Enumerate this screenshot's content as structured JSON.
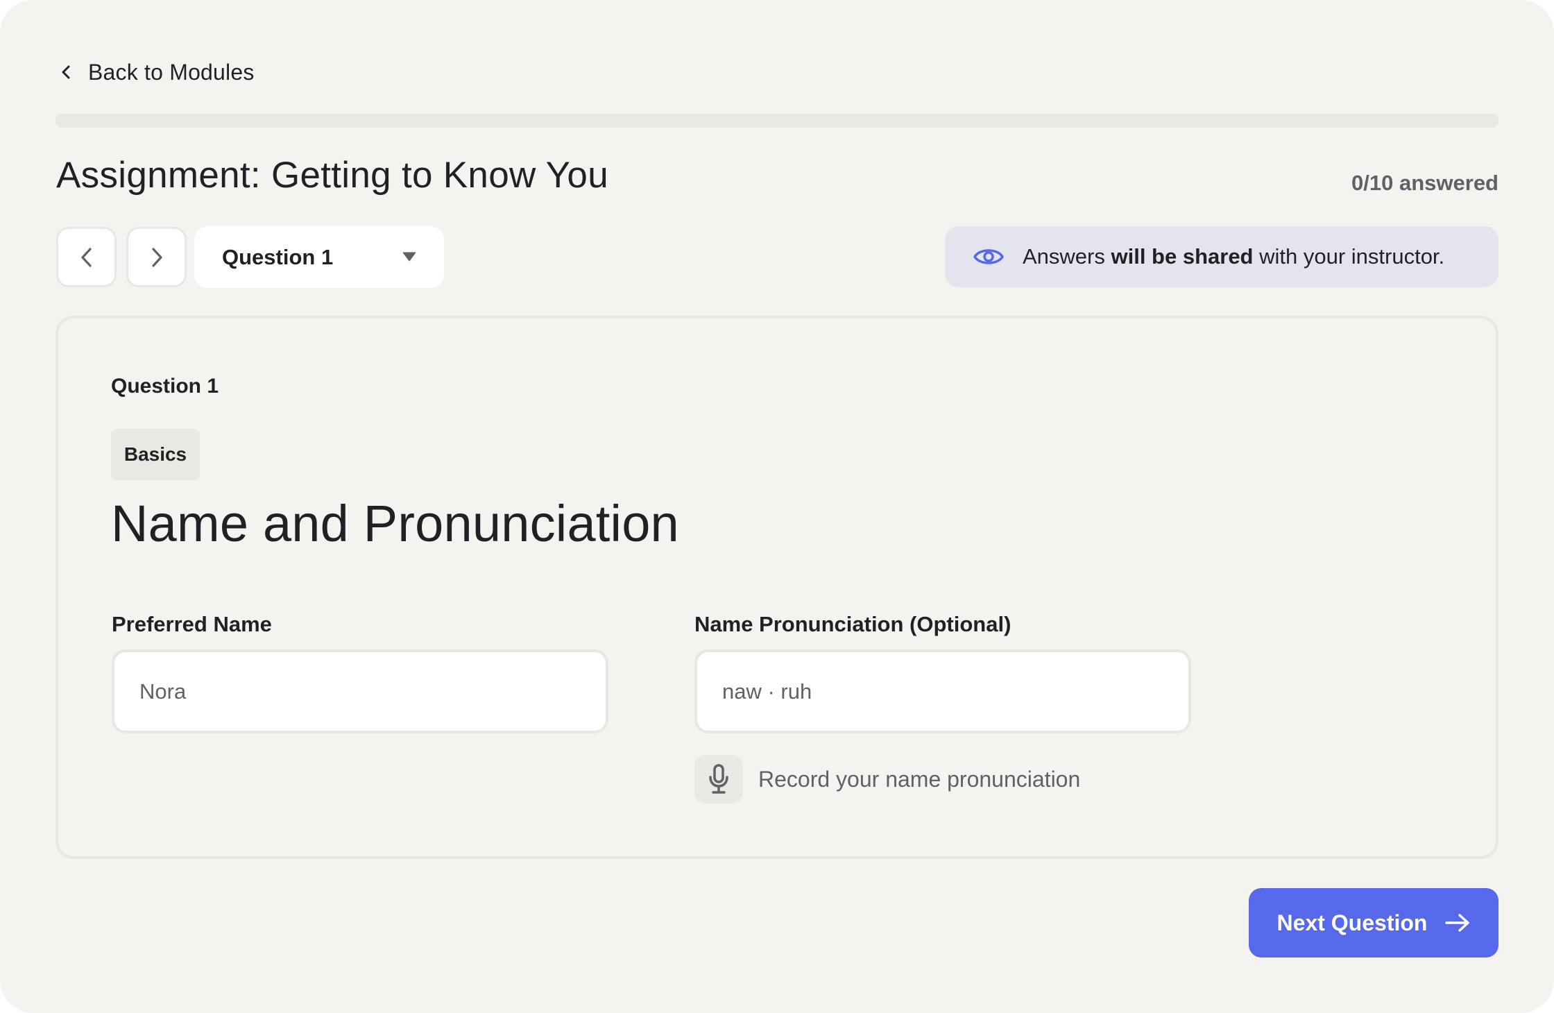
{
  "nav": {
    "back_label": "Back to Modules"
  },
  "progress": {
    "answered": 0,
    "total": 10,
    "fraction": 0
  },
  "header": {
    "title": "Assignment: Getting to Know You",
    "answered_label": "0/10 answered"
  },
  "question_nav": {
    "prev_icon": "chevron-left-icon",
    "next_icon": "chevron-right-icon",
    "selected_question": "Question 1",
    "dropdown_icon": "caret-down-icon"
  },
  "banner": {
    "icon": "eye-icon",
    "text_before": "Answers ",
    "text_bold": "will be shared",
    "text_after": " with your instructor."
  },
  "question": {
    "label": "Question 1",
    "category": "Basics",
    "heading": "Name and Pronunciation",
    "fields": [
      {
        "label": "Preferred Name",
        "value": "Nora",
        "placeholder": ""
      },
      {
        "label": "Name Pronunciation (Optional)",
        "value": "naw · ruh",
        "placeholder": ""
      }
    ],
    "record": {
      "icon": "microphone-icon",
      "label": "Record your name pronunciation"
    }
  },
  "footer": {
    "next_label": "Next Question",
    "next_icon": "arrow-right-icon"
  },
  "colors": {
    "accent": "#5569EA",
    "background": "#F4F3F0",
    "banner_bg": "#E4E4EF",
    "border": "#E9E7E2",
    "text": "#1F2124",
    "muted": "#5F6166"
  }
}
